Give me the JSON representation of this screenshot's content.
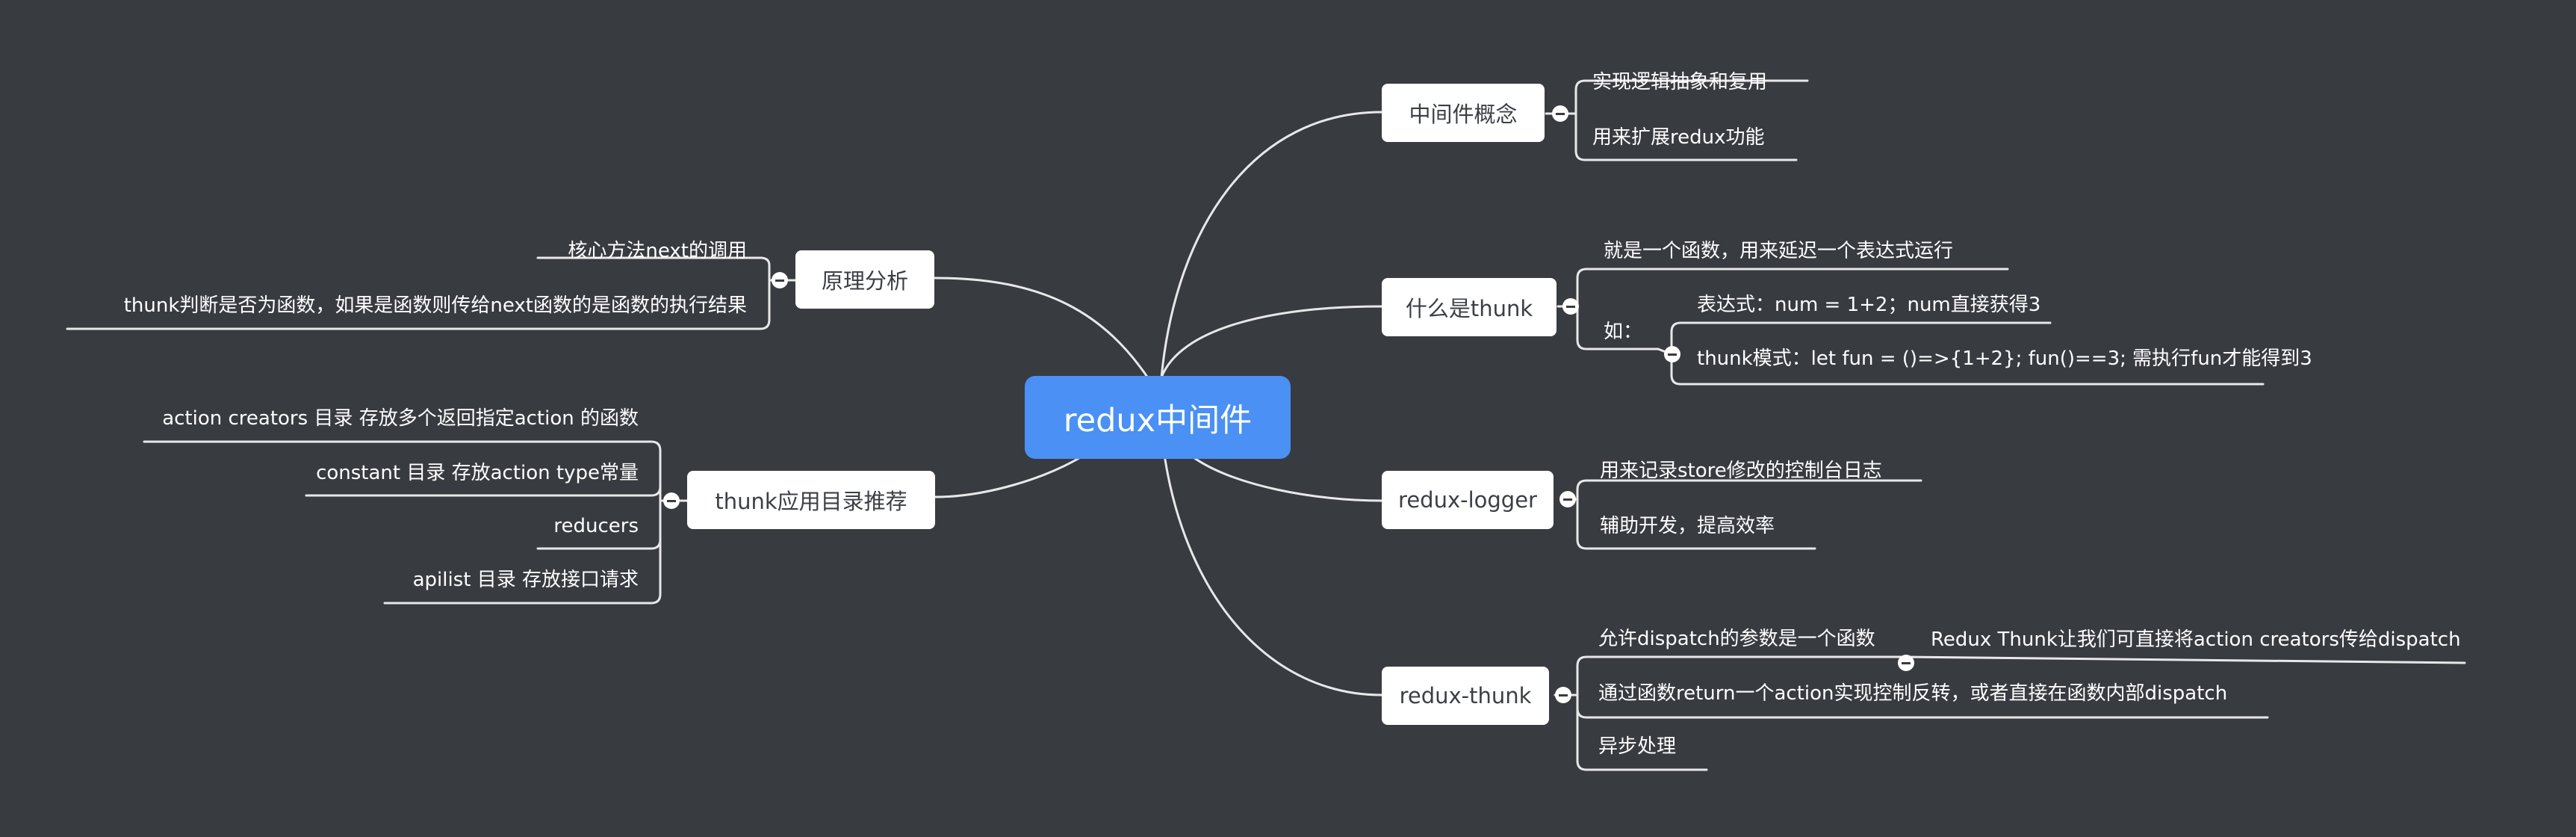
{
  "colors": {
    "background": "#383b40",
    "root": "#4a90f5",
    "node": "#ffffff",
    "line": "#e8e8e8"
  },
  "root": {
    "label": "redux中间件"
  },
  "right": [
    {
      "label": "中间件概念",
      "children": [
        "实现逻辑抽象和复用",
        "用来扩展redux功能"
      ]
    },
    {
      "label": "什么是thunk",
      "children": [
        "就是一个函数，用来延迟一个表达式运行",
        "如：",
        "表达式：num = 1+2；num直接获得3",
        "thunk模式：let fun = ()=>{1+2}; fun()==3; 需执行fun才能得到3"
      ]
    },
    {
      "label": "redux-logger",
      "children": [
        "用来记录store修改的控制台日志",
        "辅助开发，提高效率"
      ]
    },
    {
      "label": "redux-thunk",
      "children": [
        "允许dispatch的参数是一个函数",
        "Redux Thunk让我们可直接将action creators传给dispatch",
        "通过函数return一个action实现控制反转，或者直接在函数内部dispatch",
        "异步处理"
      ]
    }
  ],
  "left": [
    {
      "label": "原理分析",
      "children": [
        "核心方法next的调用",
        "thunk判断是否为函数，如果是函数则传给next函数的是函数的执行结果"
      ]
    },
    {
      "label": "thunk应用目录推荐",
      "children": [
        "action creators 目录 存放多个返回指定action 的函数",
        "constant 目录 存放action type常量",
        "reducers",
        "apilist 目录 存放接口请求"
      ]
    }
  ]
}
